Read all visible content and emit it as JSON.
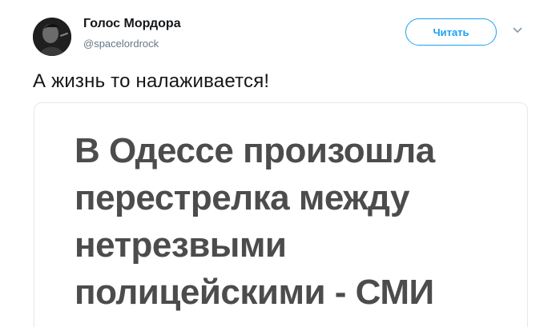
{
  "author": {
    "name": "Голос Мордора",
    "handle": "@spacelordrock"
  },
  "follow_button": {
    "label": "Читать"
  },
  "icons": {
    "avatar": "avatar-photo",
    "menu": "chevron-down-icon"
  },
  "tweet": {
    "text": "А жизнь то налаживается!"
  },
  "media": {
    "headline_lines": [
      "В Одессе произошла",
      "перестрелка между",
      "нетрезвыми",
      "полицейскими - СМИ"
    ]
  },
  "colors": {
    "accent": "#1da1f2",
    "text": "#14171a",
    "muted": "#657786",
    "headline": "#4c4c4c"
  }
}
